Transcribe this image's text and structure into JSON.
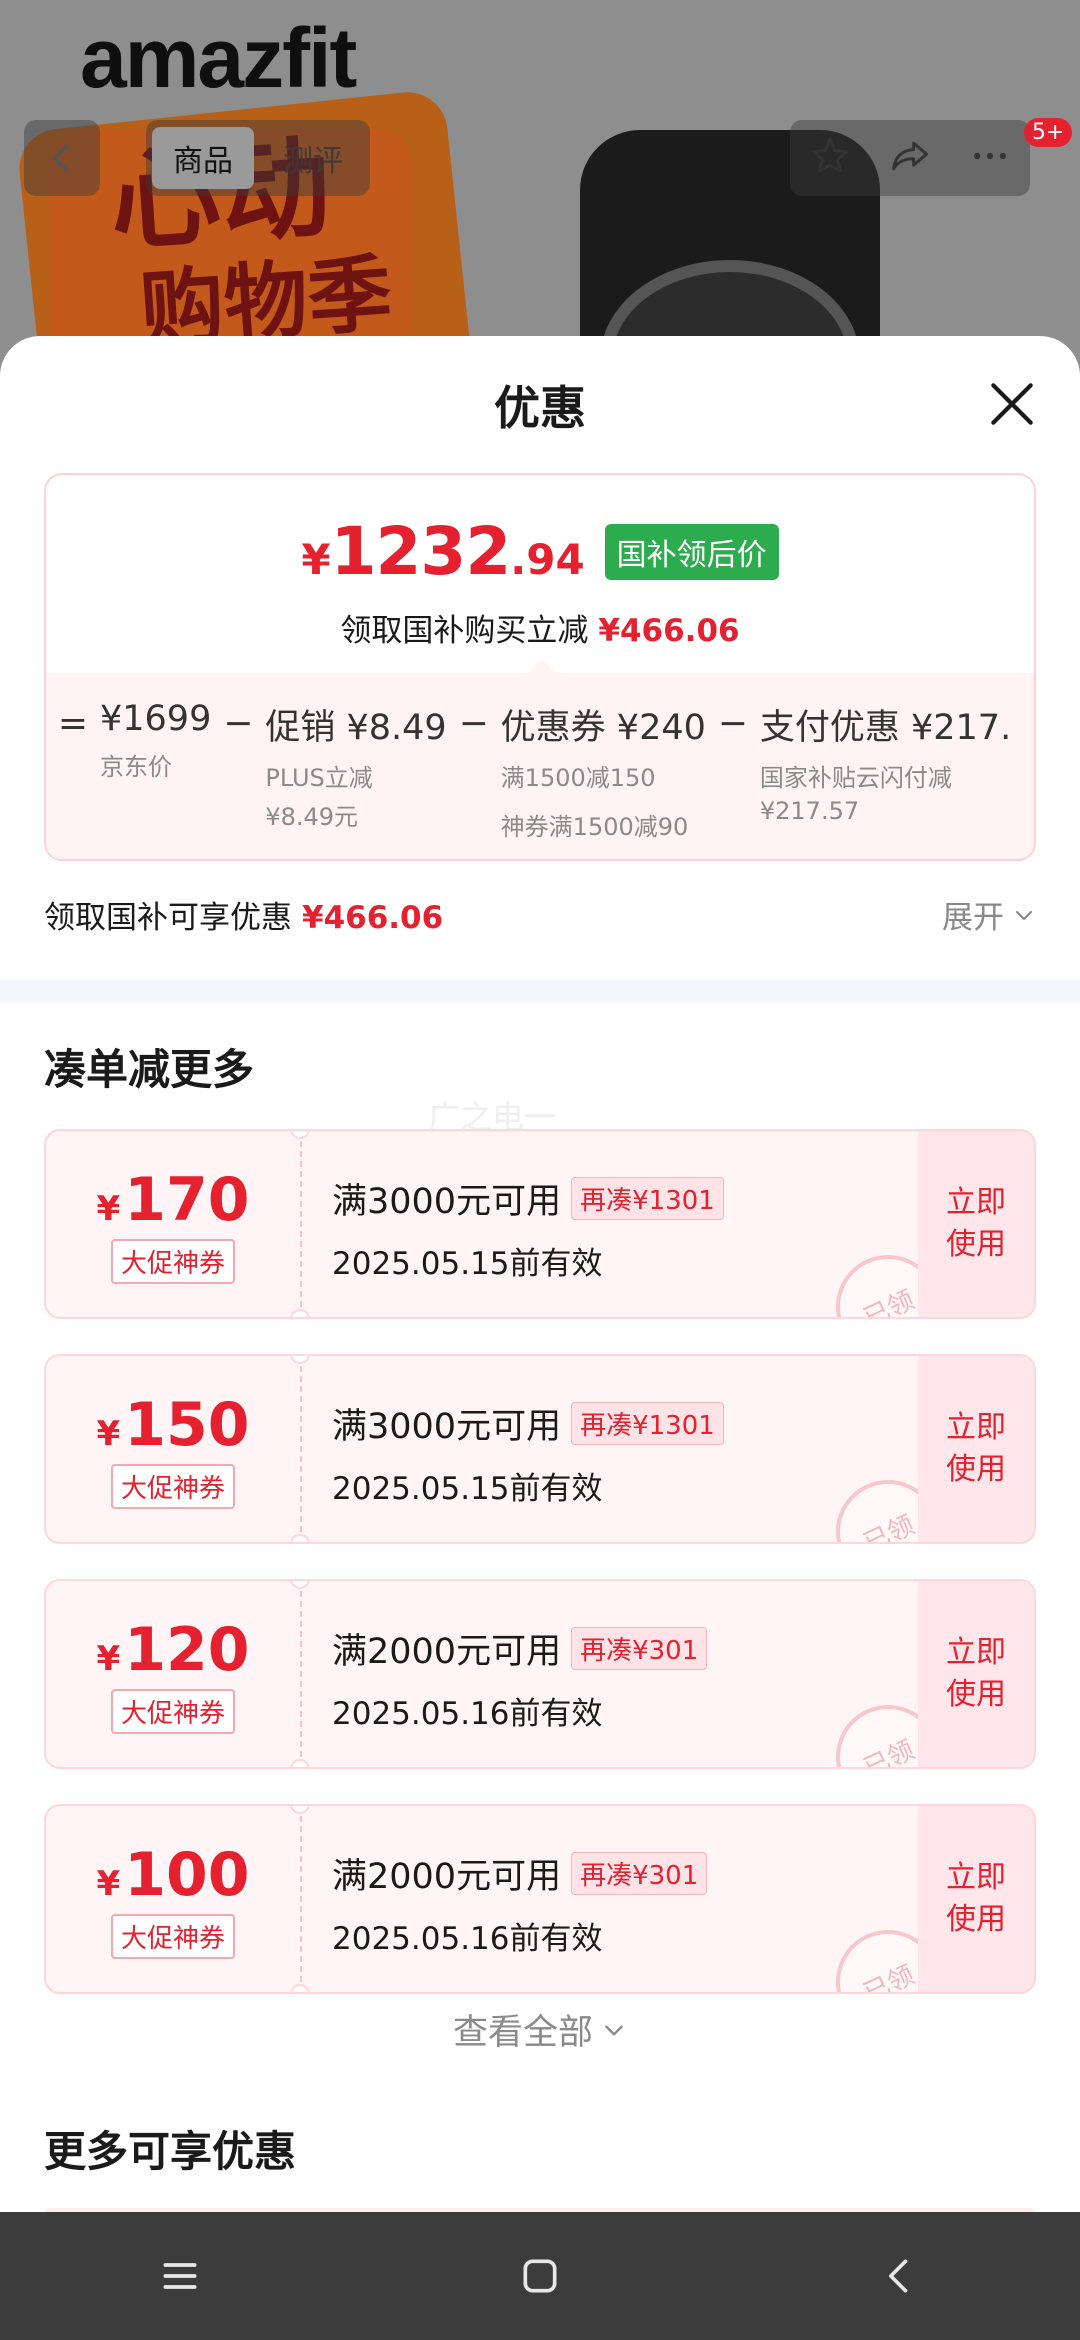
{
  "background": {
    "brand": "amazfit",
    "poster_line1": "心动",
    "poster_line2": "购物季",
    "tabs": [
      {
        "label": "商品",
        "active": true
      },
      {
        "label": "测评",
        "active": false
      }
    ],
    "cart_count": "5+"
  },
  "sheet": {
    "title": "优惠",
    "price": {
      "yen": "¥",
      "integer": "1232",
      "decimal": ".94",
      "tag": "国补领后价",
      "save_label": "领取国补购买立减",
      "save_amount": "¥466.06"
    },
    "breakdown": [
      {
        "op": "=",
        "main": "¥1699",
        "subs": [
          "京东价"
        ]
      },
      {
        "op": "−",
        "main": "促销 ¥8.49",
        "subs": [
          "PLUS立减",
          "¥8.49元"
        ]
      },
      {
        "op": "−",
        "main": "优惠券 ¥240",
        "subs": [
          "满1500减150",
          "神券满1500减90"
        ]
      },
      {
        "op": "−",
        "main": "支付优惠 ¥217.",
        "subs": [
          "国家补贴云闪付减",
          "¥217.57"
        ]
      }
    ],
    "total": {
      "label": "领取国补可享优惠",
      "amount": "¥466.06",
      "expand": "展开"
    },
    "section_more_discount": "凑单减更多",
    "watermark": "广之电一",
    "coupons": [
      {
        "yen": "¥",
        "amount": "170",
        "tag": "大促神券",
        "condition": "满3000元可用",
        "extra": "再凑¥1301",
        "date": "2025.05.15前有效",
        "action": "立即使用",
        "stamp": "已领"
      },
      {
        "yen": "¥",
        "amount": "150",
        "tag": "大促神券",
        "condition": "满3000元可用",
        "extra": "再凑¥1301",
        "date": "2025.05.15前有效",
        "action": "立即使用",
        "stamp": "已领"
      },
      {
        "yen": "¥",
        "amount": "120",
        "tag": "大促神券",
        "condition": "满2000元可用",
        "extra": "再凑¥301",
        "date": "2025.05.16前有效",
        "action": "立即使用",
        "stamp": "已领"
      },
      {
        "yen": "¥",
        "amount": "100",
        "tag": "大促神券",
        "condition": "满2000元可用",
        "extra": "再凑¥301",
        "date": "2025.05.16前有效",
        "action": "立即使用",
        "stamp": "已领"
      }
    ],
    "view_all": "查看全部",
    "section_more_offers": "更多可享优惠"
  },
  "colors": {
    "accent_red": "#e5202f",
    "subsidy_green": "#2dab4f",
    "nav_bg": "#3c3c3c"
  },
  "icons": [
    "back-arrow-icon",
    "star-icon",
    "share-icon",
    "more-dots-icon",
    "close-icon",
    "chevron-down-icon",
    "menu-icon",
    "home-square-icon",
    "back-chevron-icon"
  ]
}
